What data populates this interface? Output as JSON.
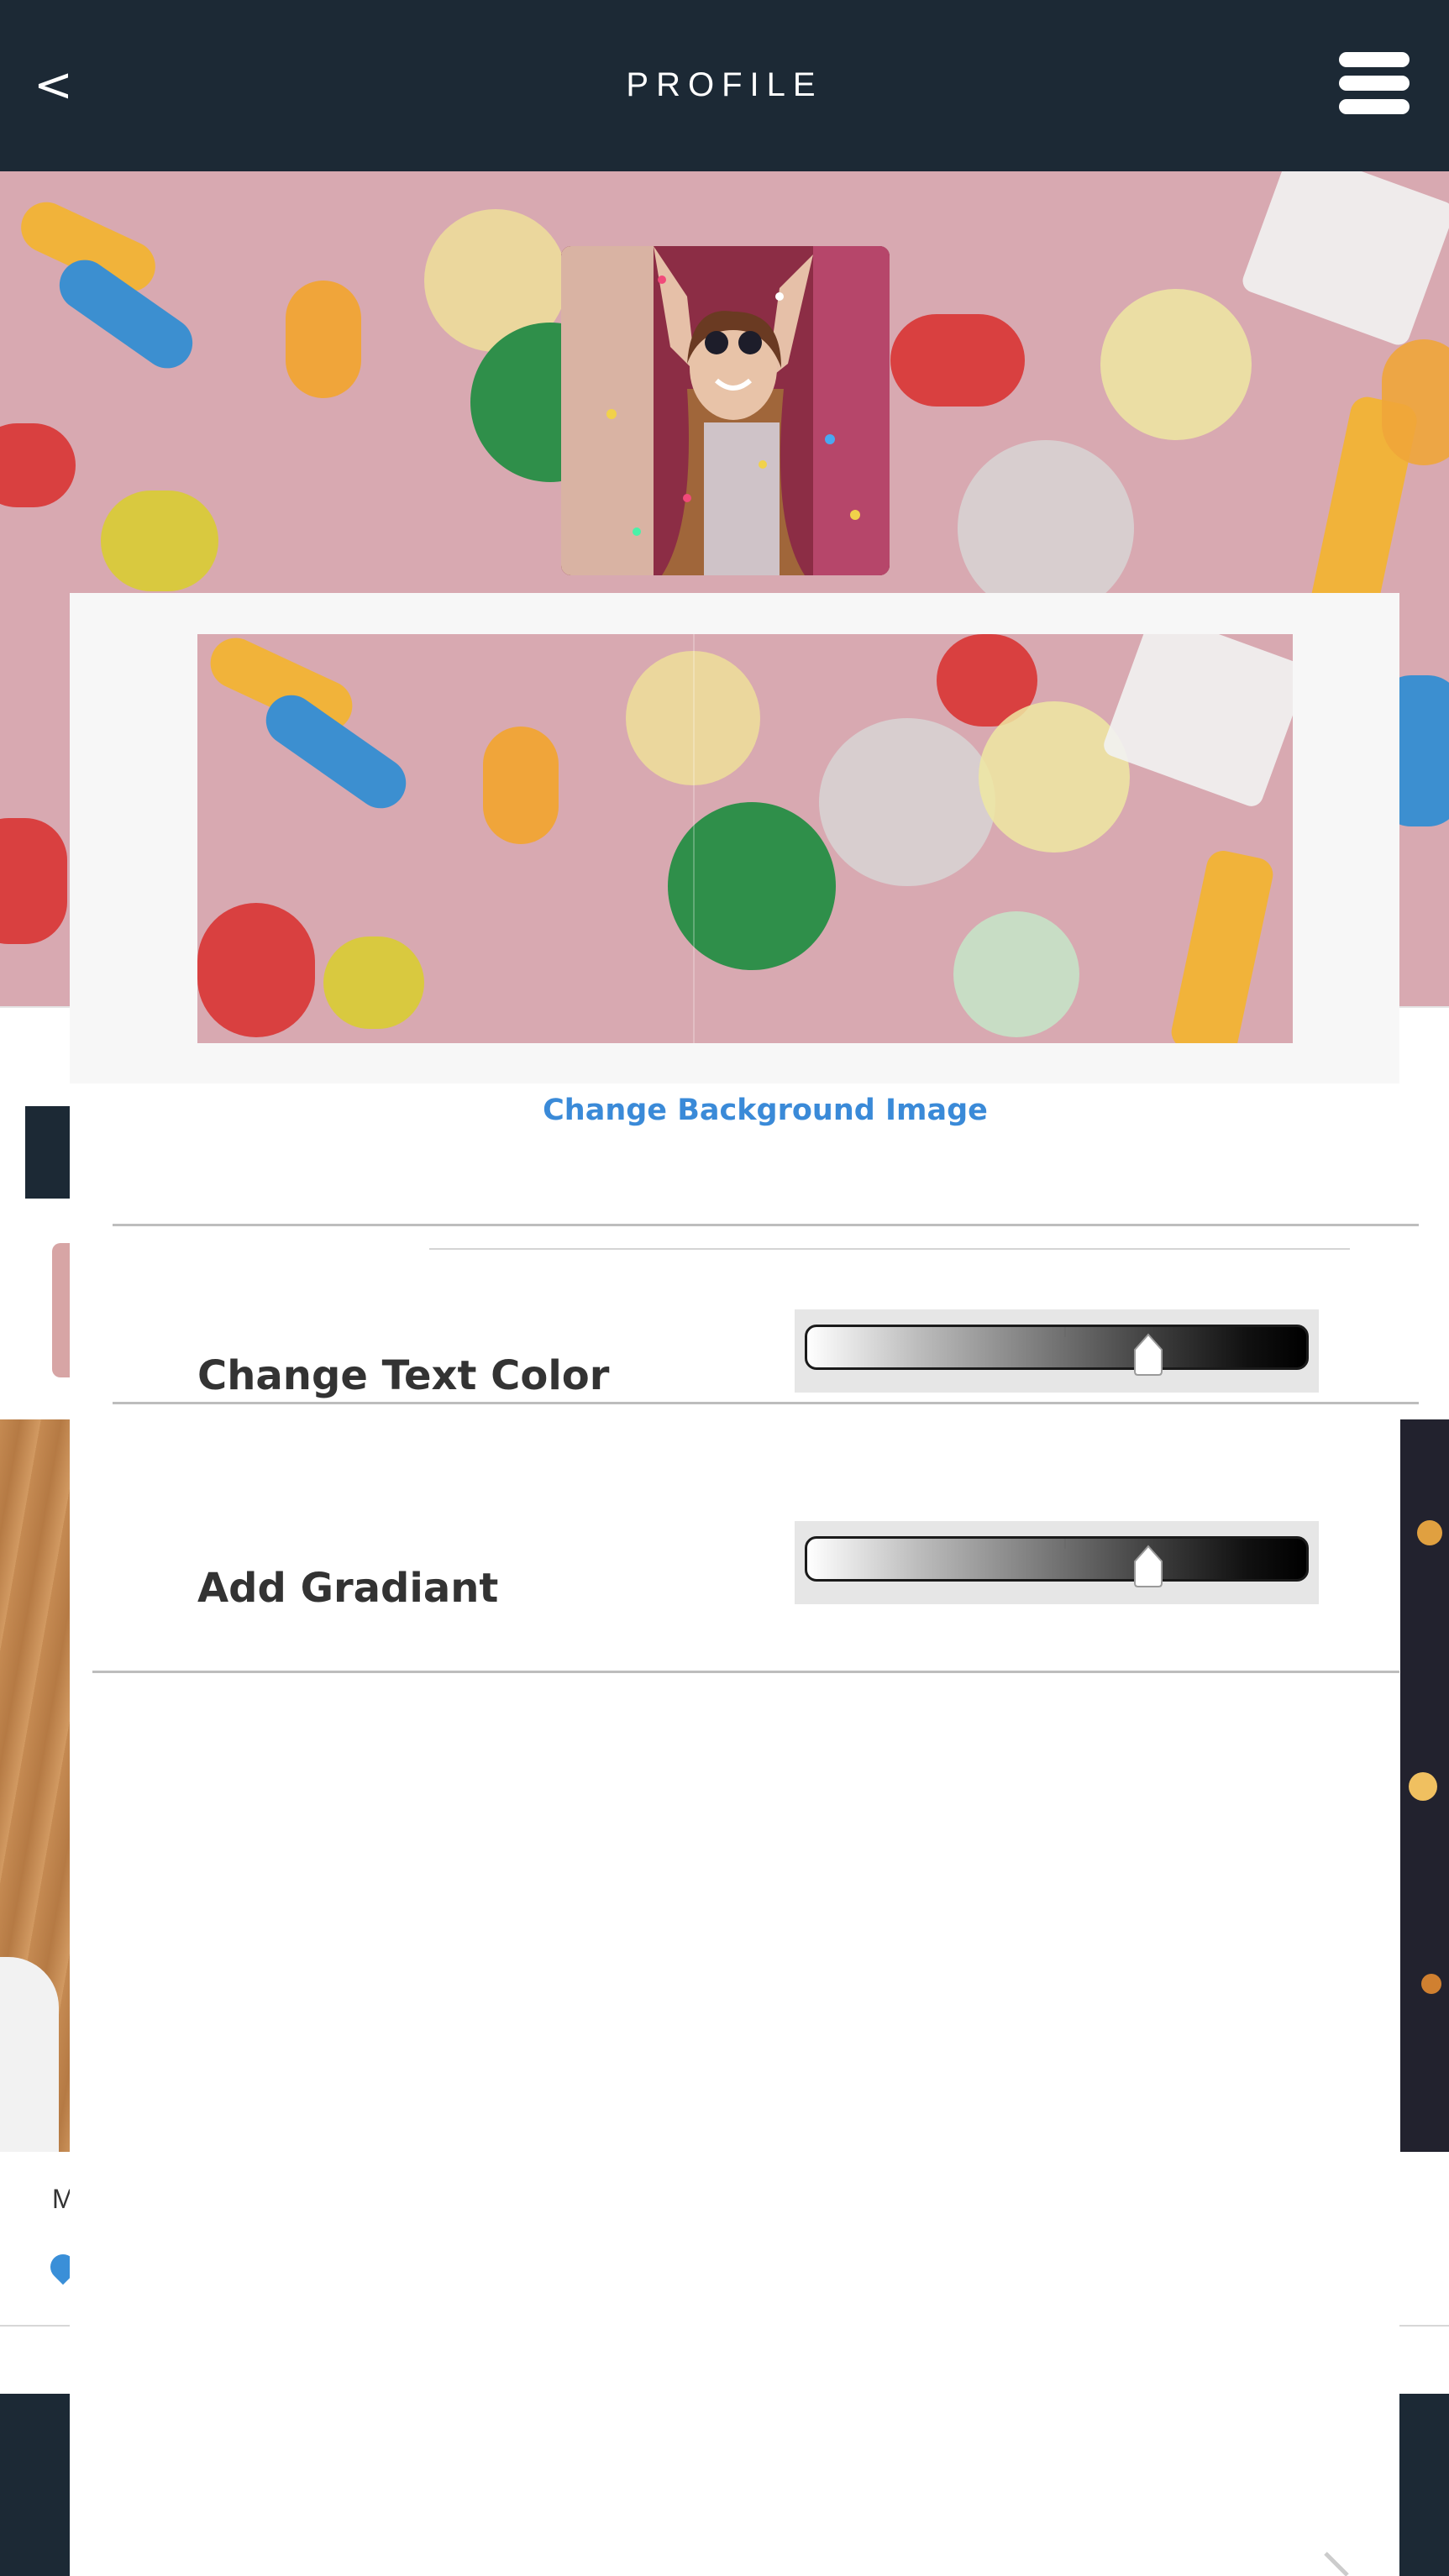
{
  "header": {
    "back_label": "<",
    "title": "PROFILE",
    "back_icon": "chevron-left-icon",
    "menu_icon": "hamburger-menu-icon",
    "background_color": "#1c2935"
  },
  "modal": {
    "change_background_label": "Change Background Image",
    "rows": [
      {
        "label": "Change Text Color",
        "slider_value_fraction": 0.68
      },
      {
        "label": "Add Gradiant",
        "slider_value_fraction": 0.68
      }
    ]
  },
  "background_page": {
    "card_caption_partial": "M"
  },
  "colors": {
    "link": "#3a8ad8",
    "header": "#1c2935",
    "label_text": "#333333"
  }
}
